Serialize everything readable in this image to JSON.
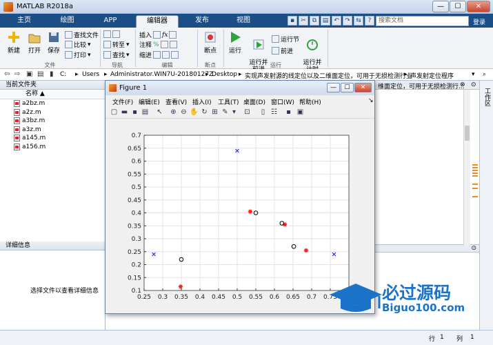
{
  "window": {
    "title": "MATLAB R2018a"
  },
  "tabs": [
    "主页",
    "绘图",
    "APP",
    "编辑器",
    "发布",
    "视图"
  ],
  "active_tab": "编辑器",
  "search": {
    "placeholder": "搜索文档"
  },
  "login_label": "登录",
  "ribbon": {
    "file_group": {
      "new": "新建",
      "open": "打开",
      "save": "保存",
      "find_files": "查找文件",
      "compare": "比较",
      "print": "打印",
      "label": "文件"
    },
    "nav_group": {
      "goto": "转至",
      "find": "查找",
      "label": "导航"
    },
    "edit_group": {
      "insert": "插入",
      "comment": "注释",
      "indent": "缩进",
      "label": "编辑"
    },
    "bp_group": {
      "breakpoints": "断点",
      "label": "断点"
    },
    "run_group": {
      "run": "运行",
      "run_advance": "运行并\n前进",
      "run_section": "运行节",
      "advance": "前进",
      "run_time": "运行并\n计时",
      "label": "运行"
    }
  },
  "address": {
    "crumbs": [
      "C:",
      "Users",
      "Administrator.WIN7U-20180127Z",
      "Desktop",
      "实现声发射源的线定位以及二维面定位，可用于无损检测行业",
      "声发射定位程序"
    ]
  },
  "current_folder": {
    "title": "当前文件夹",
    "column": "名称",
    "files": [
      "a2bz.m",
      "a2z.m",
      "a3bz.m",
      "a3z.m",
      "a145.m",
      "a156.m"
    ]
  },
  "details": {
    "title": "详细信息",
    "hint": "选择文件以查看详细信息"
  },
  "editor_tab_text": "维面定位，可用于无损检测行...",
  "workspace_label": "工作区",
  "status": {
    "row_label": "行",
    "row": "1",
    "col_label": "列",
    "col": "1"
  },
  "figure": {
    "title": "Figure 1",
    "menu": [
      "文件(F)",
      "编辑(E)",
      "查看(V)",
      "插入(I)",
      "工具(T)",
      "桌面(D)",
      "窗口(W)",
      "帮助(H)"
    ]
  },
  "chart_data": {
    "type": "scatter",
    "xlim": [
      0.25,
      0.8
    ],
    "ylim": [
      0.1,
      0.7
    ],
    "xticks": [
      "0.25",
      "0.3",
      "0.35",
      "0.4",
      "0.45",
      "0.5",
      "0.55",
      "0.6",
      "0.65",
      "0.7",
      "0.75"
    ],
    "yticks": [
      "0.1",
      "0.15",
      "0.2",
      "0.25",
      "0.3",
      "0.35",
      "0.4",
      "0.45",
      "0.5",
      "0.55",
      "0.6",
      "0.65",
      "0.7"
    ],
    "grid": true,
    "series": [
      {
        "marker": "x",
        "color": "#1a1aff",
        "points": [
          [
            0.276,
            0.24
          ],
          [
            0.5,
            0.64
          ],
          [
            0.76,
            0.24
          ]
        ]
      },
      {
        "marker": "*",
        "color": "#ff1a1a",
        "points": [
          [
            0.348,
            0.115
          ],
          [
            0.535,
            0.405
          ],
          [
            0.628,
            0.355
          ],
          [
            0.685,
            0.255
          ]
        ]
      },
      {
        "marker": "o",
        "color": "#000000",
        "points": [
          [
            0.35,
            0.22
          ],
          [
            0.55,
            0.4
          ],
          [
            0.62,
            0.36
          ],
          [
            0.652,
            0.27
          ]
        ]
      }
    ]
  },
  "watermark": {
    "cn": "必过源码",
    "en": "Biguo100.com"
  }
}
